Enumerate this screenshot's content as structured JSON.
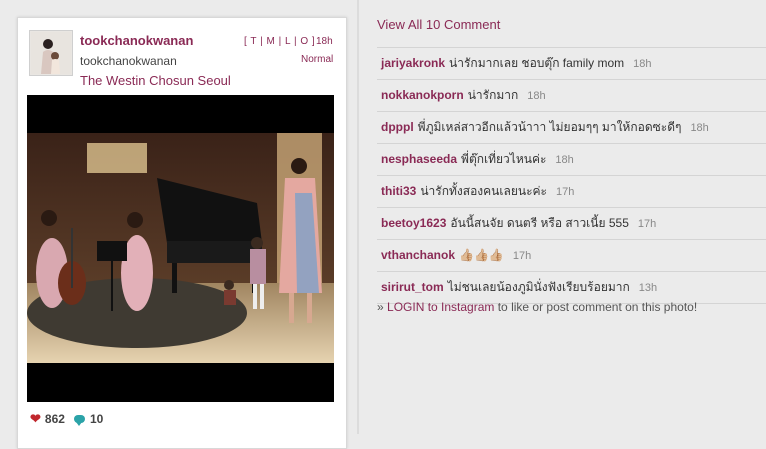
{
  "post": {
    "username": "tookchanokwanan",
    "full_name": "tookchanokwanan",
    "location": "The Westin Chosun Seoul",
    "sizes": [
      "T",
      "M",
      "L",
      "O"
    ],
    "time": "18h",
    "filter": "Normal",
    "likes": "862",
    "comments_count": "10"
  },
  "sidebar": {
    "view_all": "View All 10 Comment",
    "comments": [
      {
        "user": "jariyakronk",
        "text": "น่ารักมากเลย ชอบตุ๊ก family mom",
        "time": "18h"
      },
      {
        "user": "nokkanokporn",
        "text": "น่ารักมาก",
        "time": "18h"
      },
      {
        "user": "dpppl",
        "text": "พี่ภูมิเหล่สาวอีกแล้วน้าาา ไม่ยอมๆๆ มาให้กอดซะดีๆ",
        "time": "18h"
      },
      {
        "user": "nesphaseeda",
        "text": "พี่ตุ๊กเที่ยวไหนค่ะ",
        "time": "18h"
      },
      {
        "user": "thiti33",
        "text": "น่ารักทั้งสองคนเลยนะค่ะ",
        "time": "17h"
      },
      {
        "user": "beetoy1623",
        "text": "อันนี้สนจัย ดนตรี หรือ สาวเนี้ย 555",
        "time": "17h"
      },
      {
        "user": "vthanchanok",
        "text": "👍🏼👍🏼👍🏼",
        "time": "17h"
      },
      {
        "user": "sirirut_tom",
        "text": "ไม่ชนเลยน้องภูมินั่งฟังเรียบร้อยมาก",
        "time": "13h"
      }
    ],
    "login_prefix": "» ",
    "login_link": "LOGIN to Instagram",
    "login_suffix": " to like or post comment on this photo!"
  },
  "colors": {
    "accent": "#8a2a55",
    "heart": "#c0262c",
    "comment_icon": "#2ba3a8",
    "background": "#ebebeb"
  },
  "icons": {
    "likes": "heart-icon",
    "comments": "comment-bubble-icon"
  }
}
